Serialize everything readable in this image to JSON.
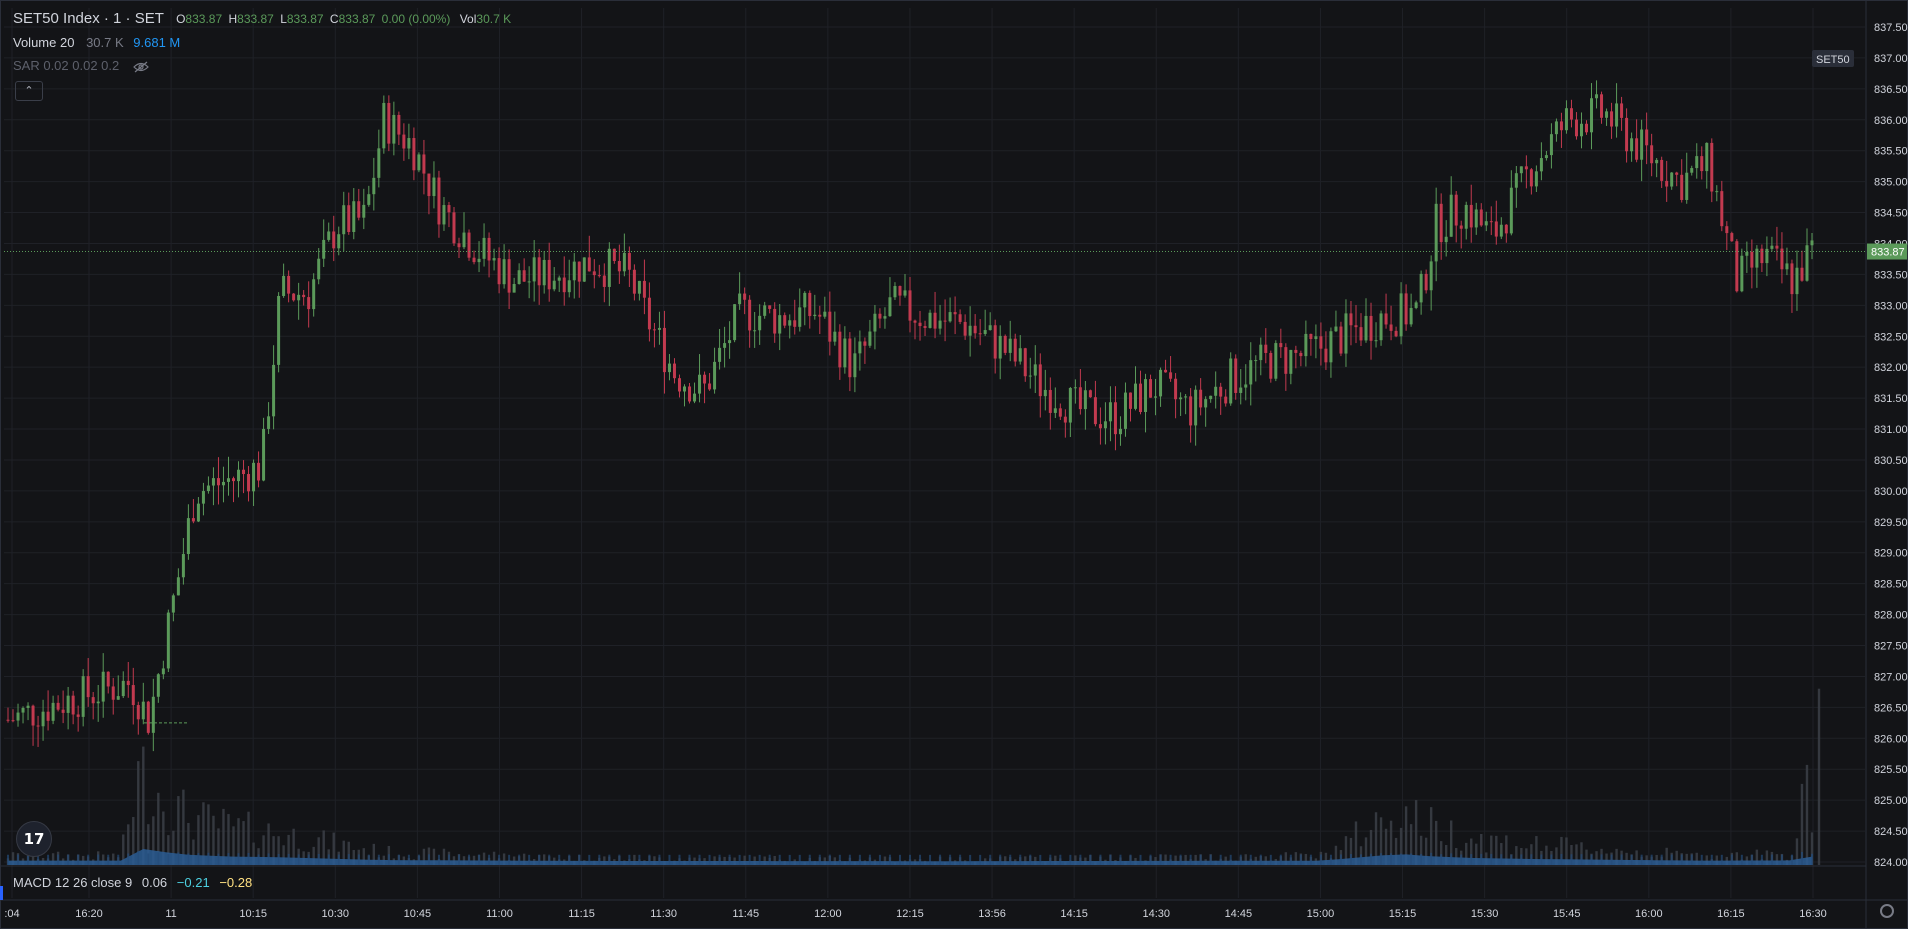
{
  "header": {
    "symbol": "SET50 Index · 1 · SET",
    "o_label": "O",
    "o_value": "833.87",
    "h_label": "H",
    "h_value": "833.87",
    "l_label": "L",
    "l_value": "833.87",
    "c_label": "C",
    "c_value": "833.87",
    "change": "0.00 (0.00%)",
    "vol_label": "Vol",
    "vol_value": "30.7 K"
  },
  "volume_legend": {
    "name": "Volume 20",
    "value": "30.7 K",
    "ma": "9.681 M"
  },
  "sar_legend": {
    "name": "SAR 0.02 0.02 0.2",
    "icon": "eye-off-icon"
  },
  "collapse_icon": "chevron-up-icon",
  "macd_legend": {
    "name": "MACD 12 26 close 9",
    "v1": "0.06",
    "v2": "−0.21",
    "v3": "−0.28"
  },
  "symbol_badge": "SET50",
  "price_label": "833.87",
  "logo_text": "17",
  "colors": {
    "background": "#131417",
    "up": "#5b9a5a",
    "down": "#c23a4f",
    "volume": "#2c5d94",
    "volume_ma": "#1f4f82",
    "grid": "#1f2127",
    "text": "#d1d4dc",
    "muted": "#787b86",
    "blue_value": "#2196f3",
    "teal_value": "#4dd0e1",
    "yellow_value": "#ffe082"
  },
  "chart_data": {
    "type": "candlestick",
    "y_ticks": [
      "837.50",
      "837.00",
      "836.50",
      "836.00",
      "835.50",
      "835.00",
      "834.50",
      "834.00",
      "833.50",
      "833.00",
      "832.50",
      "832.00",
      "831.50",
      "831.00",
      "830.50",
      "830.00",
      "829.50",
      "829.00",
      "828.50",
      "828.00",
      "827.50",
      "827.00",
      "826.50",
      "826.00",
      "825.50",
      "825.00",
      "824.50",
      "824.00"
    ],
    "ylim": [
      824.0,
      837.5
    ],
    "x_ticks": [
      ":04",
      "16:20",
      "11",
      "10:15",
      "10:30",
      "10:45",
      "11:00",
      "11:15",
      "11:30",
      "11:45",
      "12:00",
      "12:15",
      "13:56",
      "14:15",
      "14:30",
      "14:45",
      "15:00",
      "15:15",
      "15:30",
      "15:45",
      "16:00",
      "16:15",
      "16:30"
    ],
    "last_price": 833.87,
    "approx_close_path": [
      [
        0,
        826.3
      ],
      [
        0.03,
        826.6
      ],
      [
        0.065,
        826.9
      ],
      [
        0.075,
        826.3
      ],
      [
        0.1,
        830.0
      ],
      [
        0.12,
        830.2
      ],
      [
        0.135,
        830.4
      ],
      [
        0.145,
        833.2
      ],
      [
        0.16,
        833.2
      ],
      [
        0.175,
        834.3
      ],
      [
        0.19,
        834.4
      ],
      [
        0.2,
        836.0
      ],
      [
        0.215,
        835.6
      ],
      [
        0.23,
        834.6
      ],
      [
        0.25,
        833.9
      ],
      [
        0.27,
        833.4
      ],
      [
        0.29,
        833.5
      ],
      [
        0.31,
        833.7
      ],
      [
        0.33,
        833.5
      ],
      [
        0.34,
        832.8
      ],
      [
        0.355,
        831.9
      ],
      [
        0.37,
        831.6
      ],
      [
        0.39,
        832.9
      ],
      [
        0.41,
        832.8
      ],
      [
        0.43,
        832.9
      ],
      [
        0.45,
        832.0
      ],
      [
        0.47,
        833.0
      ],
      [
        0.49,
        832.8
      ],
      [
        0.51,
        832.7
      ],
      [
        0.53,
        832.3
      ],
      [
        0.55,
        831.7
      ],
      [
        0.57,
        831.3
      ],
      [
        0.59,
        831.2
      ],
      [
        0.61,
        831.7
      ],
      [
        0.63,
        831.3
      ],
      [
        0.65,
        831.8
      ],
      [
        0.67,
        832.1
      ],
      [
        0.69,
        832.2
      ],
      [
        0.71,
        832.5
      ],
      [
        0.73,
        832.8
      ],
      [
        0.75,
        832.9
      ],
      [
        0.76,
        834.3
      ],
      [
        0.775,
        834.6
      ],
      [
        0.79,
        834.1
      ],
      [
        0.81,
        835.2
      ],
      [
        0.83,
        836.0
      ],
      [
        0.85,
        836.1
      ],
      [
        0.87,
        835.5
      ],
      [
        0.89,
        835.0
      ],
      [
        0.905,
        835.3
      ],
      [
        0.92,
        833.4
      ],
      [
        0.935,
        833.8
      ],
      [
        0.95,
        833.4
      ],
      [
        0.96,
        833.87
      ]
    ],
    "approx_volume_path": [
      [
        0,
        0.05
      ],
      [
        0.06,
        0.05
      ],
      [
        0.07,
        0.5
      ],
      [
        0.09,
        0.3
      ],
      [
        0.1,
        0.25
      ],
      [
        0.12,
        0.2
      ],
      [
        0.14,
        0.18
      ],
      [
        0.2,
        0.07
      ],
      [
        0.3,
        0.04
      ],
      [
        0.5,
        0.03
      ],
      [
        0.7,
        0.05
      ],
      [
        0.74,
        0.3
      ],
      [
        0.76,
        0.2
      ],
      [
        0.78,
        0.15
      ],
      [
        0.8,
        0.12
      ],
      [
        0.9,
        0.05
      ],
      [
        0.95,
        0.06
      ],
      [
        0.958,
        0.75
      ],
      [
        0.96,
        0.2
      ]
    ]
  }
}
